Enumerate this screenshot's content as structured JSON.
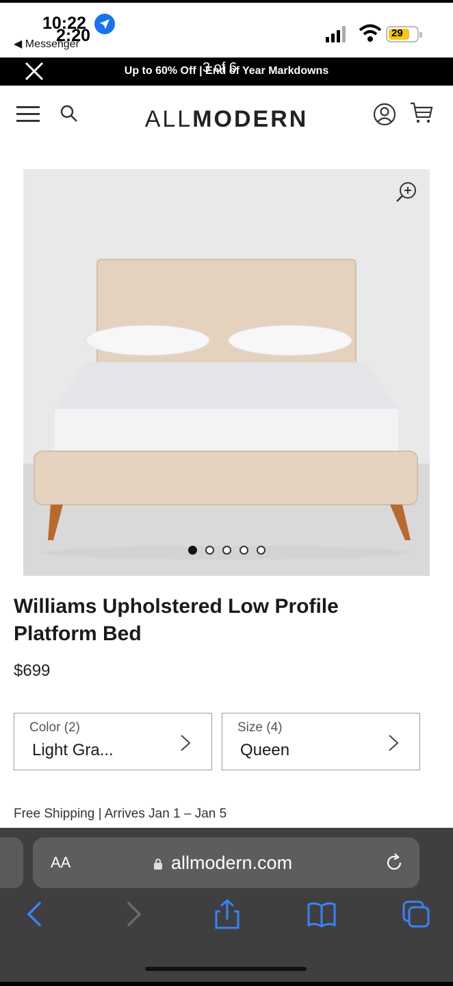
{
  "status_bar": {
    "time_primary": "10:22",
    "time_secondary": "2:20",
    "back_app": "◀ Messenger",
    "battery": "29"
  },
  "promo": {
    "text": "Up to 60% Off | End of Year Markdowns",
    "counter": "3 of 6"
  },
  "header": {
    "logo_light": "ALL",
    "logo_bold": "MODERN"
  },
  "gallery": {
    "image_alt": "Upholstered platform bed",
    "slide_count": 5,
    "active_slide": 1
  },
  "product": {
    "title": "Williams Upholstered Low Profile Platform Bed",
    "price": "$699",
    "color_label": "Color (2)",
    "color_value": "Light Gra...",
    "size_label": "Size (4)",
    "size_value": "Queen",
    "shipping": "Free Shipping  |  Arrives Jan 1 – Jan 5"
  },
  "browser": {
    "aa_label": "AA",
    "url": "allmodern.com"
  },
  "colors": {
    "promo_bg": "#000000",
    "safari_bar": "#3f3f41",
    "safari_accent": "#3b82f6",
    "bed_fabric": "#e4d2bf"
  }
}
